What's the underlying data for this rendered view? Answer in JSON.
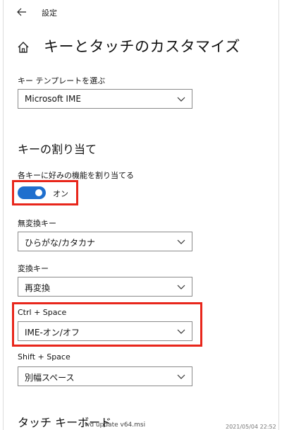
{
  "window": {
    "title": "設定"
  },
  "page": {
    "title": "キーとタッチのカスタマイズ"
  },
  "template": {
    "label": "キー テンプレートを選ぶ",
    "value": "Microsoft IME"
  },
  "assign": {
    "heading": "キーの割り当て",
    "toggle_label": "各キーに好みの機能を割り当てる",
    "toggle_state": "オン"
  },
  "muhenkan": {
    "label": "無変換キー",
    "value": "ひらがな/カタカナ"
  },
  "henkan": {
    "label": "変換キー",
    "value": "再変換"
  },
  "ctrl_space": {
    "label": "Ctrl + Space",
    "value": "IME-オン/オフ"
  },
  "shift_space": {
    "label": "Shift + Space",
    "value": "別幅スペース"
  },
  "touch": {
    "heading": "タッチ キーボード"
  },
  "overlay": {
    "file": "wd update v64.msi",
    "date": "2021/05/04 22:52"
  },
  "colors": {
    "accent": "#1f6fce",
    "highlight": "#e8261b"
  }
}
